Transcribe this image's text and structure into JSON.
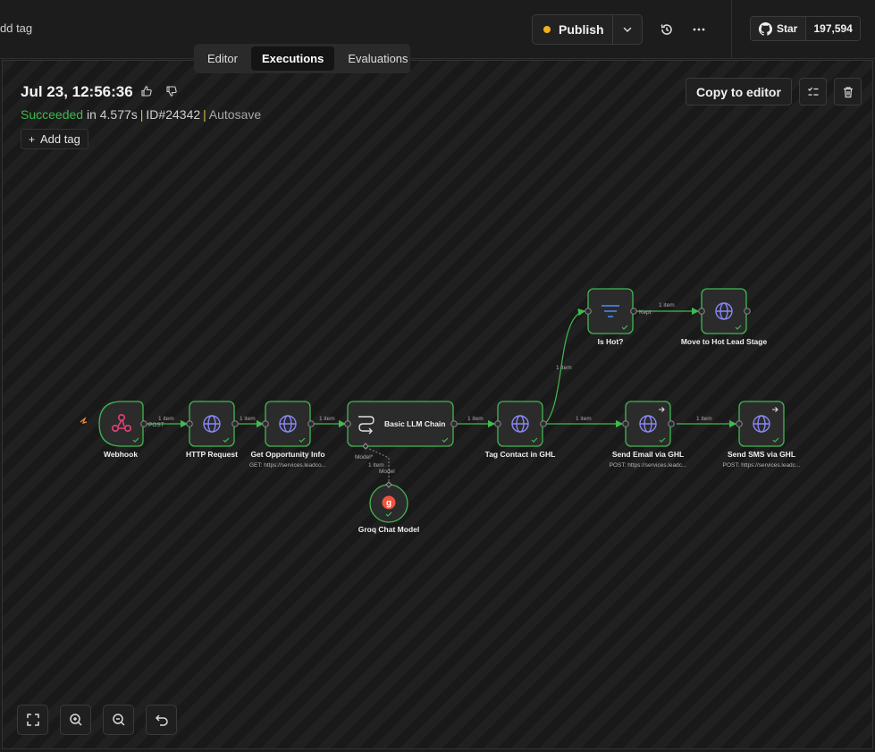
{
  "header": {
    "add_tag_partial": "dd tag",
    "publish_label": "Publish",
    "star_label": "Star",
    "star_count": "197,594",
    "publish_status_color": "#f2b01e"
  },
  "tabs": [
    {
      "label": "Editor"
    },
    {
      "label": "Executions"
    },
    {
      "label": "Evaluations"
    }
  ],
  "execution": {
    "title": "Jul 23, 12:56:36",
    "status": "Succeeded",
    "duration": "in 4.577s",
    "id": "ID#24342",
    "autosave": "Autosave",
    "add_tag": "Add tag",
    "copy_to_editor": "Copy to editor"
  },
  "nodes": {
    "webhook": {
      "label": "Webhook",
      "icon": "webhook-icon"
    },
    "http_request": {
      "label": "HTTP Request",
      "icon": "globe-icon"
    },
    "get_opportunity": {
      "label": "Get Opportunity Info",
      "sub": "GET: https://services.leadco...",
      "icon": "globe-icon"
    },
    "llm_chain": {
      "label": "Basic LLM Chain",
      "icon": "chain-icon"
    },
    "groq": {
      "label": "Groq Chat Model",
      "icon": "groq-icon"
    },
    "tag_contact": {
      "label": "Tag Contact in GHL",
      "icon": "globe-icon"
    },
    "is_hot": {
      "label": "Is Hot?",
      "icon": "filter-icon"
    },
    "move_stage": {
      "label": "Move to Hot Lead Stage",
      "icon": "globe-icon"
    },
    "send_email": {
      "label": "Send Email via GHL",
      "sub": "POST: https://services.leadc...",
      "icon": "globe-icon"
    },
    "send_sms": {
      "label": "Send SMS via GHL",
      "sub": "POST: https://services.leadc...",
      "icon": "globe-icon"
    }
  },
  "edges": {
    "item": "1 item",
    "post": "POST",
    "kept": "Kept",
    "model": "Model",
    "model_required": "Model*"
  },
  "colors": {
    "success": "#3fb950",
    "edge": "#3fb950",
    "globe": "#8a87f5",
    "webhook": "#e5407a",
    "filter": "#4c8cf5",
    "groq": "#f0533f"
  }
}
